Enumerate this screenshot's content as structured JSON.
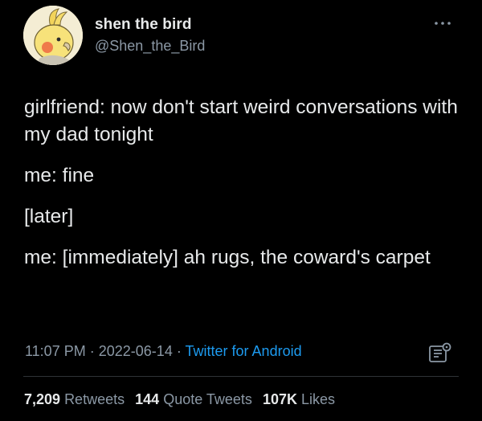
{
  "author": {
    "display_name": "shen the bird",
    "handle": "@Shen_the_Bird"
  },
  "tweet": {
    "lines": [
      "girlfriend: now don't start weird conversations with my dad tonight",
      "me: fine",
      "[later]",
      "me: [immediately] ah rugs, the coward's carpet"
    ],
    "time": "11:07 PM",
    "separator": "·",
    "date": "2022-06-14",
    "source": "Twitter for Android"
  },
  "stats": {
    "retweets_count": "7,209",
    "retweets_label": "Retweets",
    "quotes_count": "144",
    "quotes_label": "Quote Tweets",
    "likes_count": "107K",
    "likes_label": "Likes"
  },
  "colors": {
    "background": "#000000",
    "text": "#e7e9ea",
    "secondary": "#8b98a5",
    "link": "#1d9bf0",
    "divider": "#2f3336"
  },
  "icons": {
    "more": "more-horizontal-icon",
    "analytics": "analytics-icon"
  }
}
